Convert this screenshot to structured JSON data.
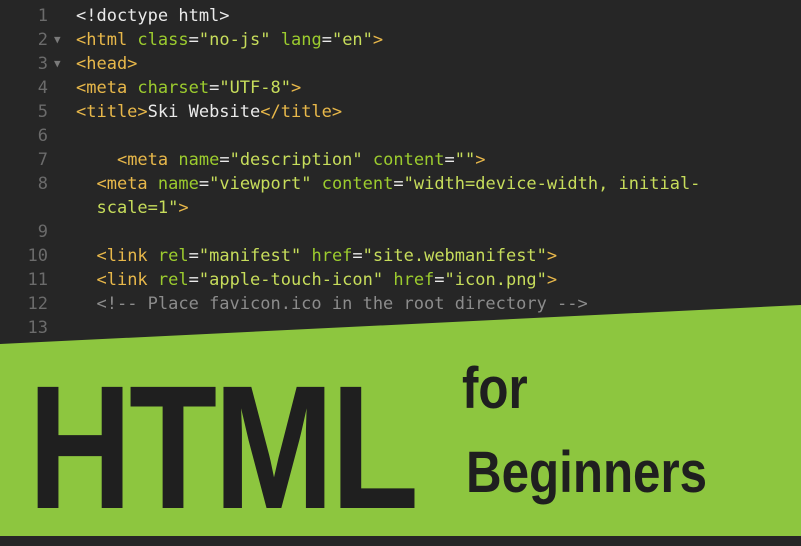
{
  "editor": {
    "lines": [
      {
        "num": "1",
        "fold": false,
        "parts": [
          [
            "txt",
            "<!doctype html>"
          ]
        ]
      },
      {
        "num": "2",
        "fold": true,
        "parts": [
          [
            "tag",
            "<html "
          ],
          [
            "attr",
            "class"
          ],
          [
            "txt",
            "="
          ],
          [
            "str",
            "\"no-js\" "
          ],
          [
            "attr",
            "lang"
          ],
          [
            "txt",
            "="
          ],
          [
            "str",
            "\"en\""
          ],
          [
            "tag",
            ">"
          ]
        ]
      },
      {
        "num": "3",
        "fold": true,
        "parts": [
          [
            "tag",
            "<head>"
          ]
        ]
      },
      {
        "num": "4",
        "fold": false,
        "parts": [
          [
            "tag",
            "<meta "
          ],
          [
            "attr",
            "charset"
          ],
          [
            "txt",
            "="
          ],
          [
            "str",
            "\"UTF-8\""
          ],
          [
            "tag",
            ">"
          ]
        ]
      },
      {
        "num": "5",
        "fold": false,
        "parts": [
          [
            "tag",
            "<title>"
          ],
          [
            "txt",
            "Ski Website"
          ],
          [
            "tag",
            "</title>"
          ]
        ]
      },
      {
        "num": "6",
        "fold": false,
        "parts": []
      },
      {
        "num": "7",
        "fold": false,
        "parts": [
          [
            "txt",
            "    "
          ],
          [
            "tag",
            "<meta "
          ],
          [
            "attr",
            "name"
          ],
          [
            "txt",
            "="
          ],
          [
            "str",
            "\"description\" "
          ],
          [
            "attr",
            "content"
          ],
          [
            "txt",
            "="
          ],
          [
            "str",
            "\"\""
          ],
          [
            "tag",
            ">"
          ]
        ]
      },
      {
        "num": "8",
        "fold": false,
        "parts": [
          [
            "txt",
            "  "
          ],
          [
            "tag",
            "<meta "
          ],
          [
            "attr",
            "name"
          ],
          [
            "txt",
            "="
          ],
          [
            "str",
            "\"viewport\" "
          ],
          [
            "attr",
            "content"
          ],
          [
            "txt",
            "="
          ],
          [
            "str",
            "\"width=device-width, initial-"
          ]
        ]
      },
      {
        "num": "",
        "fold": false,
        "parts": [
          [
            "txt",
            "  "
          ],
          [
            "str",
            "scale=1\""
          ],
          [
            "tag",
            ">"
          ]
        ]
      },
      {
        "num": "9",
        "fold": false,
        "parts": []
      },
      {
        "num": "10",
        "fold": false,
        "parts": [
          [
            "txt",
            "  "
          ],
          [
            "tag",
            "<link "
          ],
          [
            "attr",
            "rel"
          ],
          [
            "txt",
            "="
          ],
          [
            "str",
            "\"manifest\" "
          ],
          [
            "attr",
            "href"
          ],
          [
            "txt",
            "="
          ],
          [
            "str",
            "\"site.webmanifest\""
          ],
          [
            "tag",
            ">"
          ]
        ]
      },
      {
        "num": "11",
        "fold": false,
        "parts": [
          [
            "txt",
            "  "
          ],
          [
            "tag",
            "<link "
          ],
          [
            "attr",
            "rel"
          ],
          [
            "txt",
            "="
          ],
          [
            "str",
            "\"apple-touch-icon\" "
          ],
          [
            "attr",
            "href"
          ],
          [
            "txt",
            "="
          ],
          [
            "str",
            "\"icon.png\""
          ],
          [
            "tag",
            ">"
          ]
        ]
      },
      {
        "num": "12",
        "fold": false,
        "parts": [
          [
            "txt",
            "  "
          ],
          [
            "cmt",
            "<!-- Place favicon.ico in the root directory -->"
          ]
        ]
      },
      {
        "num": "13",
        "fold": false,
        "parts": []
      }
    ],
    "fold_icon": "fold-triangle-icon"
  },
  "banner": {
    "title_big": "HTML",
    "title_for": "for",
    "title_beginners": "Beginners",
    "color": "#8dc63f"
  }
}
